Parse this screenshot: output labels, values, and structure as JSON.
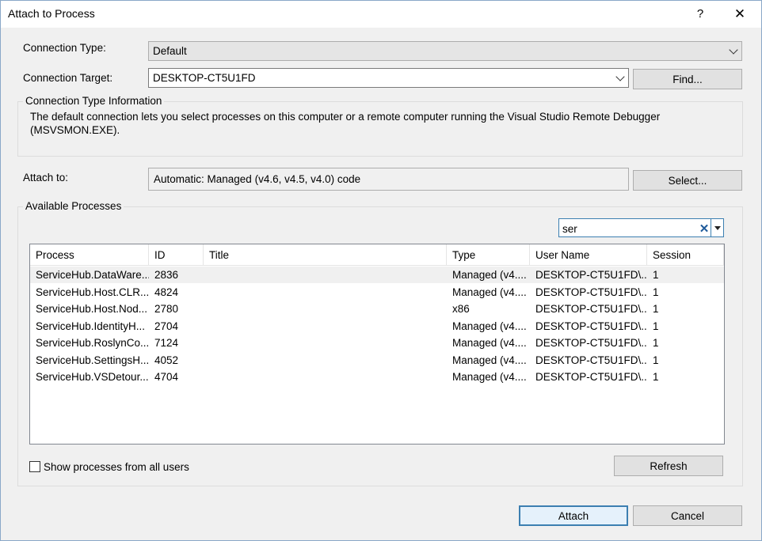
{
  "window": {
    "title": "Attach to Process",
    "help_glyph": "?",
    "close_glyph": "✕"
  },
  "connection": {
    "type_label": "Connection Type:",
    "type_value": "Default",
    "target_label": "Connection Target:",
    "target_value": "DESKTOP-CT5U1FD",
    "find_label": "Find..."
  },
  "info": {
    "caption": "Connection Type Information",
    "text_line1": "The default connection lets you select processes on this computer or a remote computer running the Visual Studio Remote Debugger",
    "text_line2": "(MSVSMON.EXE)."
  },
  "attach_to": {
    "label": "Attach to:",
    "value": "Automatic: Managed (v4.6, v4.5, v4.0) code",
    "select_label": "Select..."
  },
  "processes": {
    "caption": "Available Processes",
    "filter_value": "ser",
    "clear_glyph": "✕",
    "columns": [
      "Process",
      "ID",
      "Title",
      "Type",
      "User Name",
      "Session"
    ],
    "rows": [
      [
        "ServiceHub.DataWare...",
        "2836",
        "",
        "Managed (v4....",
        "DESKTOP-CT5U1FD\\...",
        "1"
      ],
      [
        "ServiceHub.Host.CLR....",
        "4824",
        "",
        "Managed (v4....",
        "DESKTOP-CT5U1FD\\...",
        "1"
      ],
      [
        "ServiceHub.Host.Nod...",
        "2780",
        "",
        "x86",
        "DESKTOP-CT5U1FD\\...",
        "1"
      ],
      [
        "ServiceHub.IdentityH...",
        "2704",
        "",
        "Managed (v4....",
        "DESKTOP-CT5U1FD\\...",
        "1"
      ],
      [
        "ServiceHub.RoslynCo...",
        "7124",
        "",
        "Managed (v4....",
        "DESKTOP-CT5U1FD\\...",
        "1"
      ],
      [
        "ServiceHub.SettingsH...",
        "4052",
        "",
        "Managed (v4....",
        "DESKTOP-CT5U1FD\\...",
        "1"
      ],
      [
        "ServiceHub.VSDetour...",
        "4704",
        "",
        "Managed (v4....",
        "DESKTOP-CT5U1FD\\...",
        "1"
      ]
    ],
    "show_all_label": "Show processes from all users",
    "show_all_checked": false,
    "refresh_label": "Refresh"
  },
  "footer": {
    "attach_label": "Attach",
    "cancel_label": "Cancel"
  }
}
